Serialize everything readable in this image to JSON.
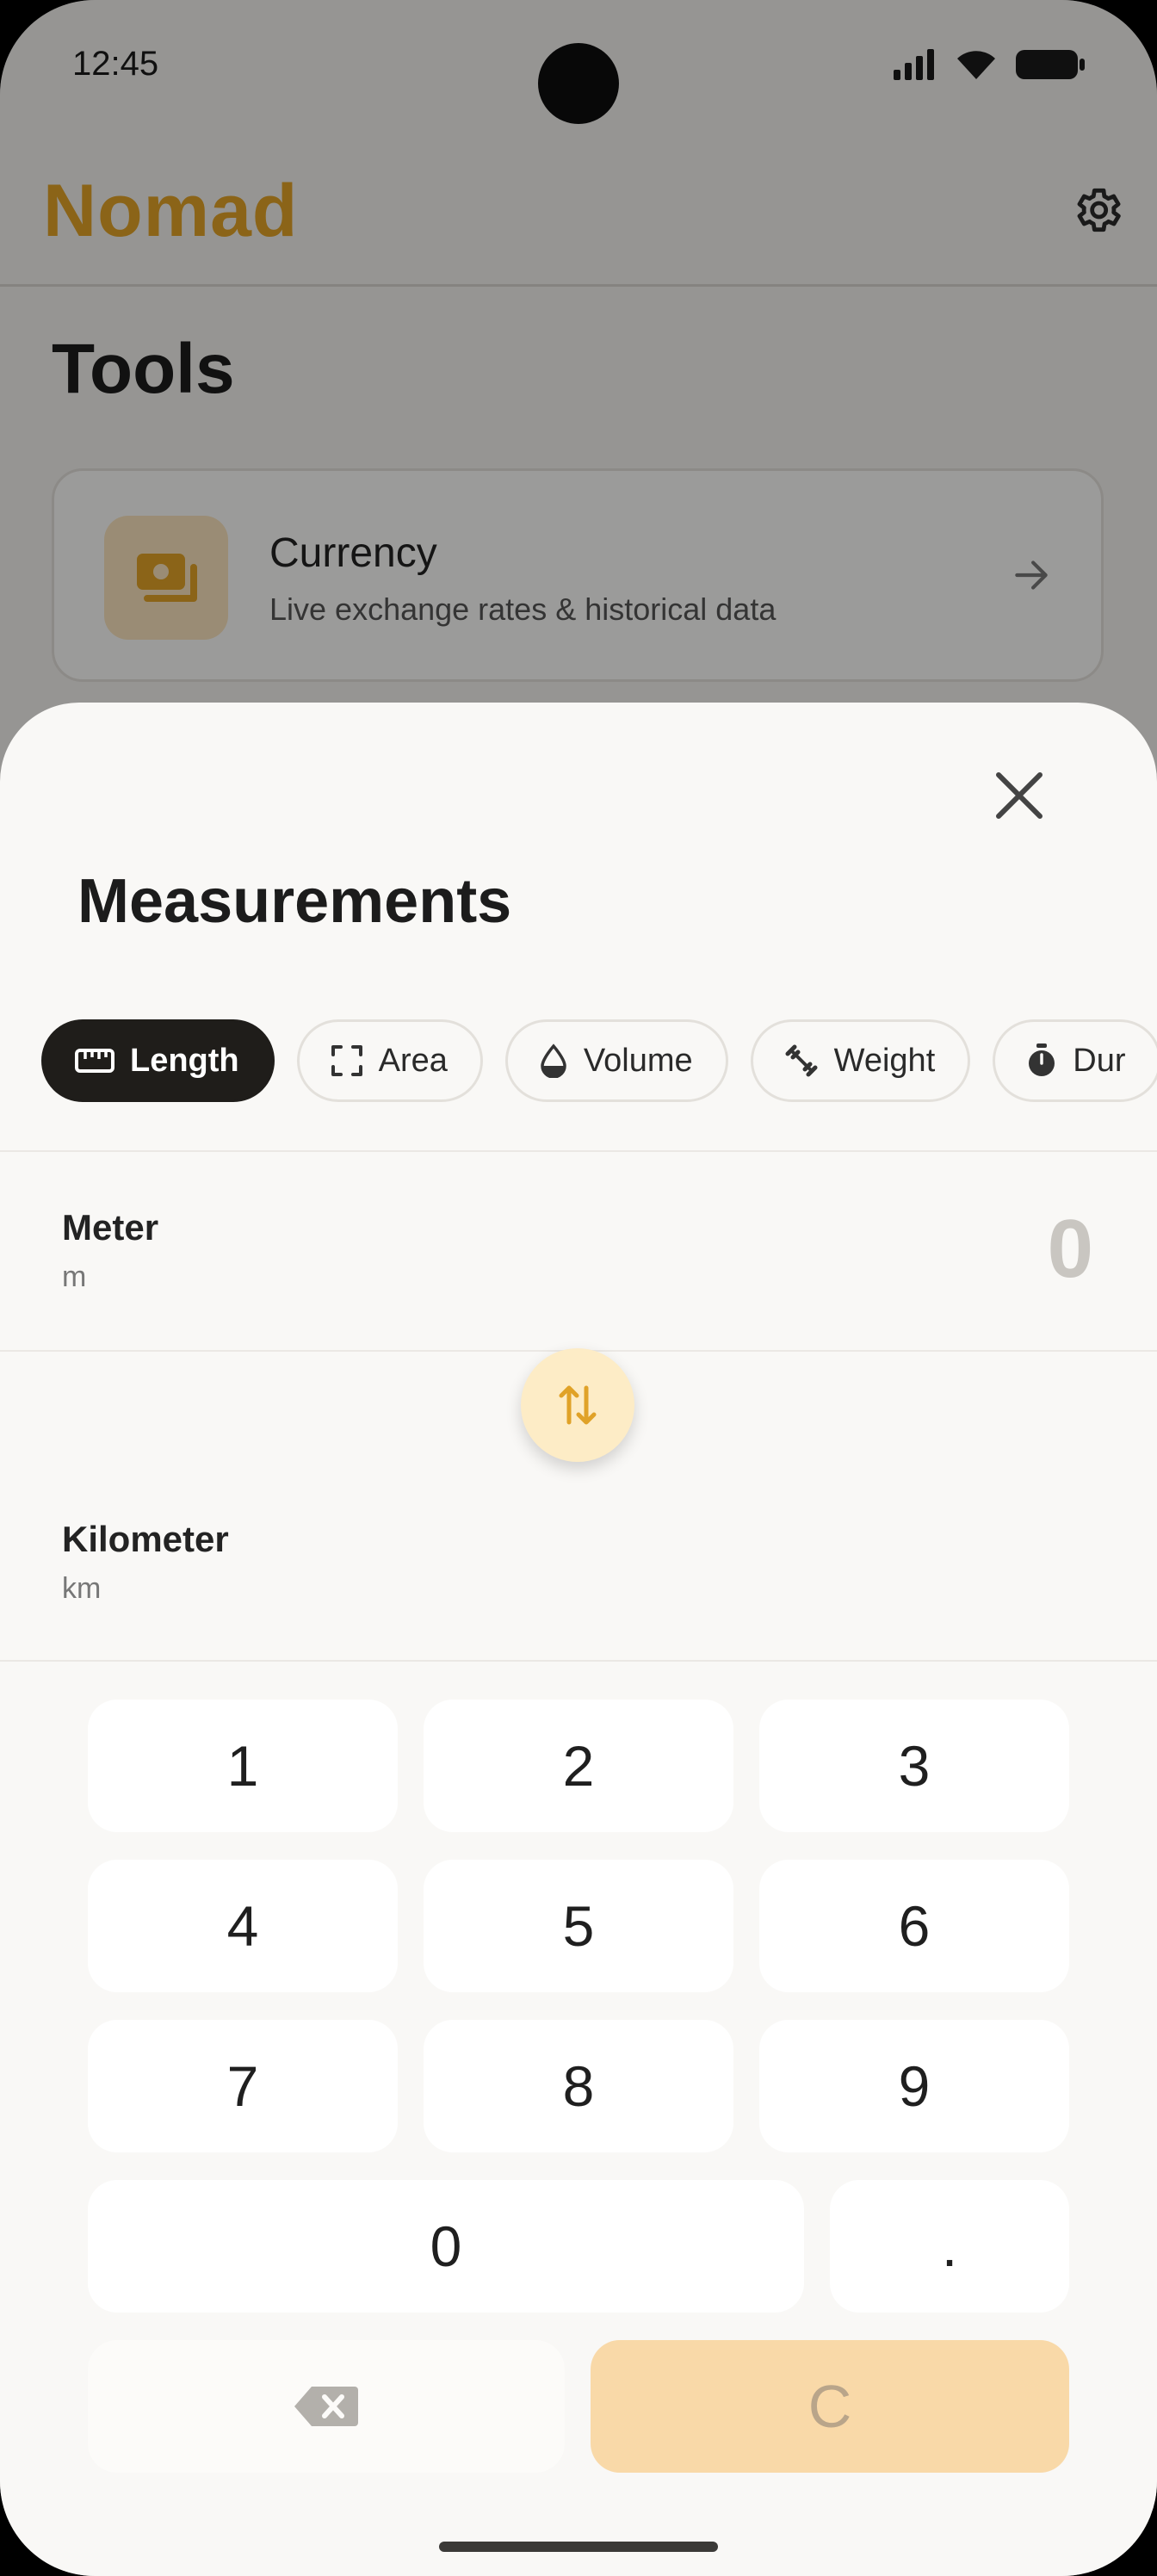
{
  "status_bar": {
    "time": "12:45"
  },
  "app": {
    "brand": "Nomad"
  },
  "tools": {
    "title": "Tools",
    "currency_card": {
      "title": "Currency",
      "subtitle": "Live exchange rates & historical data"
    }
  },
  "sheet": {
    "title": "Measurements",
    "categories": [
      {
        "label": "Length",
        "icon": "ruler-icon",
        "selected": true
      },
      {
        "label": "Area",
        "icon": "area-frame-icon",
        "selected": false
      },
      {
        "label": "Volume",
        "icon": "drop-icon",
        "selected": false
      },
      {
        "label": "Weight",
        "icon": "dumbbell-icon",
        "selected": false
      },
      {
        "label": "Dur",
        "icon": "stopwatch-icon",
        "selected": false
      }
    ],
    "from_unit": {
      "name": "Meter",
      "abbr": "m",
      "value": "0"
    },
    "to_unit": {
      "name": "Kilometer",
      "abbr": "km"
    },
    "keypad": {
      "keys": [
        "1",
        "2",
        "3",
        "4",
        "5",
        "6",
        "7",
        "8",
        "9",
        "0",
        "."
      ],
      "clear_label": "C"
    }
  },
  "colors": {
    "brand": "#e0a228",
    "accent_soft": "#f9d9a8",
    "chip_active": "#1f1d1a"
  }
}
